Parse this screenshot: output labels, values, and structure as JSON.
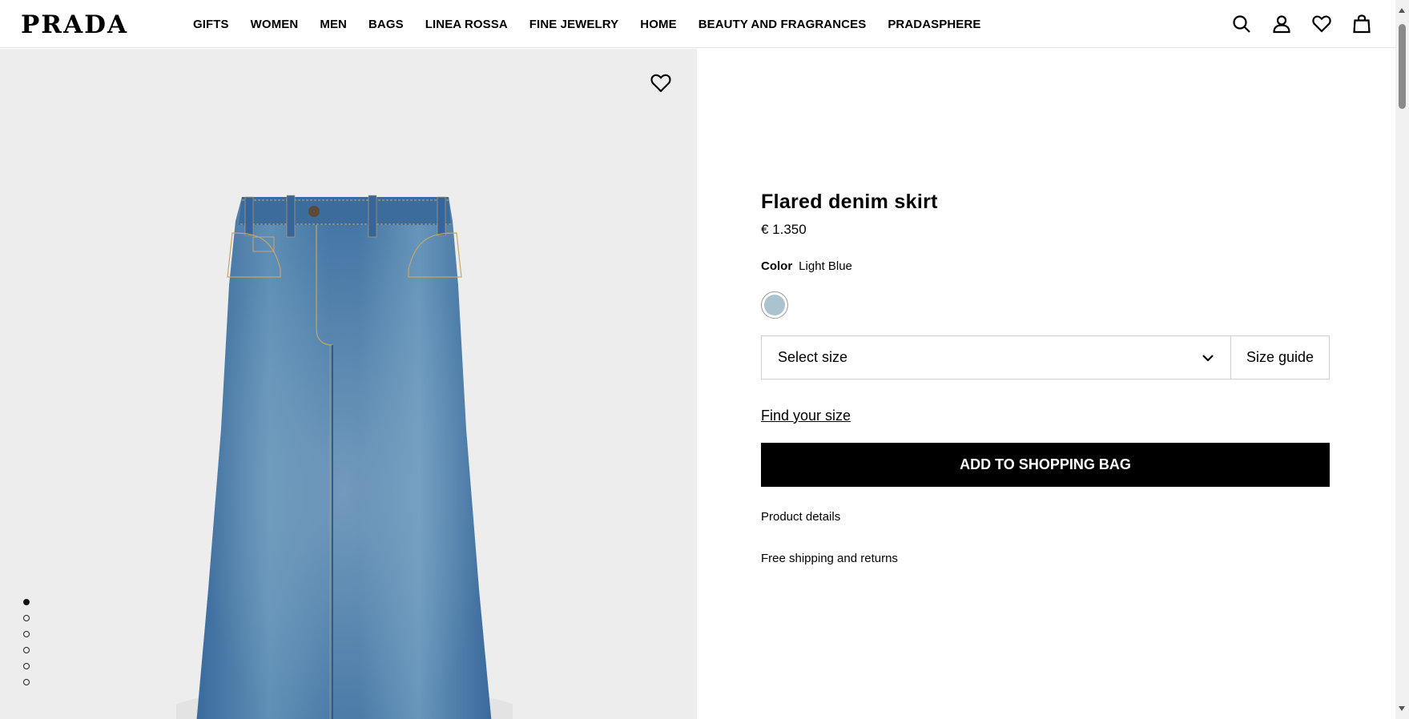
{
  "brand": {
    "logo_text": "PRADA"
  },
  "nav": {
    "items": [
      {
        "label": "GIFTS"
      },
      {
        "label": "WOMEN"
      },
      {
        "label": "MEN"
      },
      {
        "label": "BAGS"
      },
      {
        "label": "LINEA ROSSA"
      },
      {
        "label": "FINE JEWELRY"
      },
      {
        "label": "HOME"
      },
      {
        "label": "BEAUTY AND FRAGRANCES"
      },
      {
        "label": "PRADASPHERE"
      }
    ]
  },
  "header_icons": [
    "search-icon",
    "account-icon",
    "wishlist-icon",
    "shopping-bag-icon"
  ],
  "gallery": {
    "dot_count": 6,
    "active_index": 0
  },
  "product": {
    "title": "Flared denim skirt",
    "price": "€ 1.350",
    "color_label": "Color",
    "color_value": "Light Blue",
    "swatch_color": "#a9c3cf",
    "size_select_label": "Select size",
    "size_guide_label": "Size guide",
    "find_size_label": "Find your size",
    "add_to_bag_label": "ADD TO SHOPPING BAG",
    "details_label": "Product details",
    "shipping_label": "Free shipping and returns"
  }
}
